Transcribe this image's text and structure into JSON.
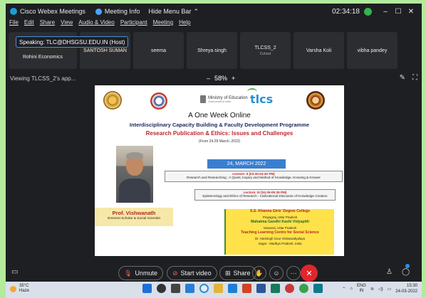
{
  "window": {
    "app_name": "Cisco Webex Meetings",
    "meeting_info": "Meeting Info",
    "hide_menu_bar": "Hide Menu Bar",
    "timer": "02:34:18",
    "minimize": "–",
    "maximize": "☐",
    "close": "✕"
  },
  "menu": [
    "File",
    "Edit",
    "Share",
    "View",
    "Audio & Video",
    "Participant",
    "Meeting",
    "Help"
  ],
  "speaking": "Speaking: TLC@DHSGSU.EDU.IN (Host)",
  "participants": [
    {
      "name": "Rohini Economics",
      "sub": ""
    },
    {
      "name": "SANTOSH SUMAN",
      "sub": ""
    },
    {
      "name": "seema",
      "sub": ""
    },
    {
      "name": "Shreya singh",
      "sub": ""
    },
    {
      "name": "TLCSS_2",
      "sub": "Cohost"
    },
    {
      "name": "Varsha Koli",
      "sub": ""
    },
    {
      "name": "vibha pandey",
      "sub": ""
    }
  ],
  "viewing": "Viewing TLCSS_2's app...",
  "zoom": {
    "minus": "–",
    "level": "58%",
    "plus": "+"
  },
  "slide": {
    "ministry": "Ministry of Education",
    "ministry_sub": "Government of India",
    "tlcs": "tlcs",
    "line1": "A One Week Online",
    "line2": "Interdisciplinary Capacity Building & Faculty Development Programme",
    "line3": "Research Publication & Ethics: Issues and Challenges",
    "line4": "(From 24-29 March, 2022)",
    "date": "24, MARCH 2022",
    "lecture2_title": "Lecture: II (03:30-04:30 PM)",
    "lecture2_text": "Research and Researching : A Quest, Inquiry and Method of Knowledge, Knowing & Knower",
    "lecture3_title": "Lecture: III (04:35-05:35 PM)",
    "lecture3_text": "Epistemology and Ethics of Research : Civilizational Discourse of Knowledge Creation",
    "prof_name": "Prof. Vishwanath",
    "prof_desc": "Eminent Scholar & Social Scientist",
    "org1": "S.S. Khanna Girls' Degree College",
    "org1_loc": "Prayagraj, Uttar Pradesh",
    "org2": "Mahatma Gandhi Kashi Vidyapith",
    "org2_loc": "Varanasi, Uttar Pradesh",
    "org3": "Teaching Learning Centre for Social Science",
    "org3_sub": "Dr. Harisingh Gour Vishwavidyalaya",
    "org3_loc": "Sagar - Madhya Pradesh, India"
  },
  "controls": {
    "unmute": "Unmute",
    "start_video": "Start video",
    "share": "Share",
    "more": "···"
  },
  "taskbar": {
    "temp": "35°C",
    "weather": "Haze",
    "lang1": "ENG",
    "lang2": "IN",
    "time": "15:30",
    "date": "24-03-2022"
  },
  "colors": {
    "desktop_bg": "#b4ea9b",
    "app_bg": "#1e1f22",
    "leave_red": "#e1262c",
    "recording_green": "#37b24d"
  }
}
